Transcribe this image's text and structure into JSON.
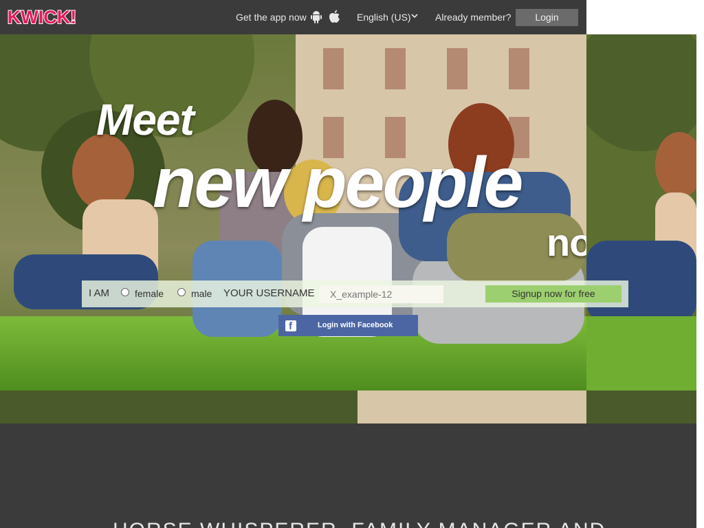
{
  "header": {
    "logo_text": "KWICK!",
    "get_app_label": "Get the app now",
    "android_icon": "android-icon",
    "apple_icon": "apple-icon",
    "language_label": "English (US)",
    "already_member_label": "Already member?",
    "login_label": "Login"
  },
  "hero": {
    "line1": "Meet",
    "line2": "new people",
    "line3": "now!"
  },
  "signup": {
    "i_am_label": "I AM",
    "gender_options": [
      "female",
      "male"
    ],
    "username_label": "YOUR USERNAME",
    "username_placeholder": "X_example-12",
    "signup_button_label": "Signup now for free",
    "facebook_label": "Login with Facebook"
  },
  "footer": {
    "title": "HORSE WHISPERER, FAMILY MANAGER AND"
  },
  "colors": {
    "header_bg": "#3b3b3b",
    "logo_pink": "#e8195c",
    "signup_green": "#9ccf6f",
    "facebook_blue": "#4c66a4"
  }
}
